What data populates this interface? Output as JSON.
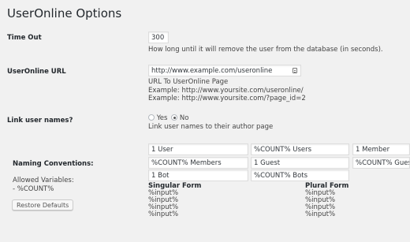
{
  "page": {
    "title": "UserOnline Options"
  },
  "timeout": {
    "label": "Time Out",
    "value": "300",
    "description": "How long until it will remove the user from the database (in seconds)."
  },
  "url": {
    "label": "UserOnline URL",
    "value": "http://www.example.com/useronline",
    "description": "URL To UserOnline Page",
    "example1": "Example: http://www.yoursite.com/useronline/",
    "example2": "Example: http://www.yoursite.com/?page_id=2"
  },
  "link_names": {
    "label": "Link user names?",
    "yes": "Yes",
    "no": "No",
    "selected": "No",
    "description": "Link user names to their author page"
  },
  "naming": {
    "label": "Naming Conventions:",
    "allowed_title": "Allowed Variables:",
    "allowed_var": "- %COUNT%",
    "restore_button": "Restore Defaults",
    "row1": [
      "1 User",
      "%COUNT% Users",
      "1 Member"
    ],
    "row2": [
      "%COUNT% Members",
      "1 Guest",
      "%COUNT% Guests"
    ],
    "row3": [
      "1 Bot",
      "%COUNT% Bots"
    ],
    "singular_head": "Singular Form",
    "plural_head": "Plural Form",
    "singular_vars": [
      "%input%",
      "%input%",
      "%input%",
      "%input%"
    ],
    "plural_vars": [
      "%input%",
      "%input%",
      "%input%",
      "%input%"
    ]
  }
}
